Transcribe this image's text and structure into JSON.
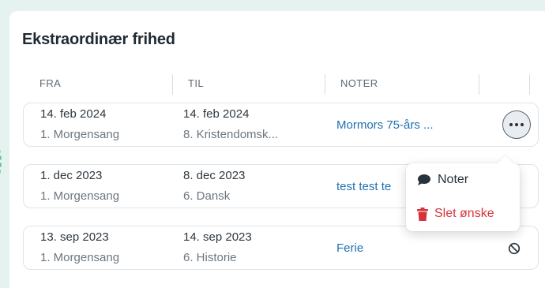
{
  "title": "Ekstraordinær frihed",
  "columns": [
    "FRA",
    "TIL",
    "NOTER"
  ],
  "rows": [
    {
      "from_date": "14. feb 2024",
      "from_lesson": "1. Morgensang",
      "to_date": "14. feb 2024",
      "to_lesson": "8. Kristendomsk...",
      "note": "Mormors 75-års ...",
      "action": "more"
    },
    {
      "from_date": "1. dec 2023",
      "from_lesson": "1. Morgensang",
      "to_date": "8. dec 2023",
      "to_lesson": "6. Dansk",
      "note": "test test te",
      "action": "none"
    },
    {
      "from_date": "13. sep 2023",
      "from_lesson": "1. Morgensang",
      "to_date": "14. sep 2023",
      "to_lesson": "6. Historie",
      "note": "Ferie",
      "action": "ban"
    }
  ],
  "menu": {
    "items": [
      {
        "label": "Noter",
        "icon": "comment-icon",
        "color": "#27323a"
      },
      {
        "label": "Slet ønske",
        "icon": "trash-icon",
        "color": "#d6333a"
      }
    ]
  },
  "colors": {
    "link": "#2270ae",
    "danger": "#d6333a",
    "background": "#e6f2ef"
  }
}
